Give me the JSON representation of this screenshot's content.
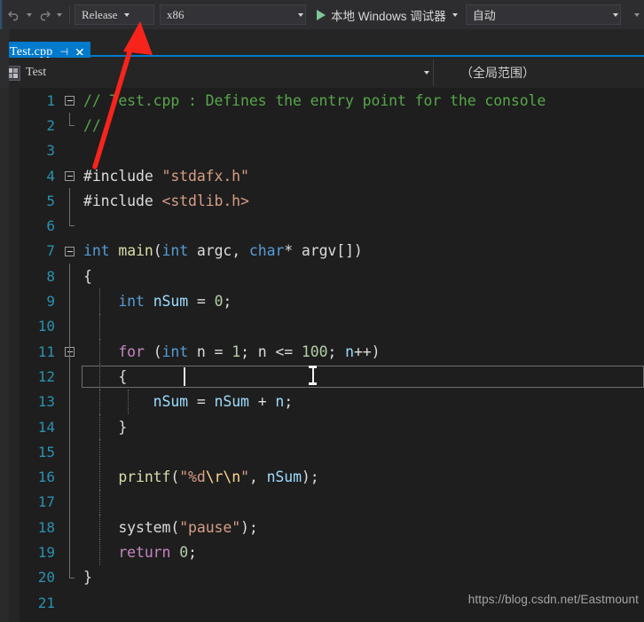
{
  "toolbar": {
    "undo_icon": "undo-arrow-icon",
    "redo_icon": "redo-arrow-icon",
    "configuration": "Release",
    "platform": "x86",
    "run_label": "本地 Windows 调试器",
    "attach_label": "自动",
    "play_icon": "play-triangle-icon",
    "caret_icon": "chevron-down-icon"
  },
  "tabstrip": {
    "active_tab": "Test.cpp",
    "pin_icon": "pin-icon",
    "close_icon": "close-x-icon"
  },
  "navbar": {
    "project_icon": "project-puzzle-icon",
    "project": "Test",
    "scope": "（全局范围）",
    "caret_icon": "chevron-down-icon"
  },
  "editor": {
    "cursor_icon": "text-ibeam-cursor",
    "lines": [
      {
        "n": "1",
        "fold": "open",
        "guides": [],
        "tokens": [
          {
            "t": "// Test.cpp : Defines the entry point for the console",
            "c": "tk-cmt"
          }
        ]
      },
      {
        "n": "2",
        "fold": "end",
        "guides": [],
        "tokens": [
          {
            "t": "//",
            "c": "tk-cmt"
          }
        ]
      },
      {
        "n": "3",
        "fold": "none",
        "guides": [],
        "tokens": []
      },
      {
        "n": "4",
        "fold": "open",
        "guides": [],
        "tokens": [
          {
            "t": "#include ",
            "c": "tk-pp"
          },
          {
            "t": "\"stdafx.h\"",
            "c": "tk-str"
          }
        ]
      },
      {
        "n": "5",
        "fold": "line",
        "guides": [],
        "tokens": [
          {
            "t": "#include ",
            "c": "tk-pp"
          },
          {
            "t": "<stdlib.h>",
            "c": "tk-str"
          }
        ]
      },
      {
        "n": "6",
        "fold": "endhalf",
        "guides": [],
        "tokens": []
      },
      {
        "n": "7",
        "fold": "open",
        "guides": [],
        "tokens": [
          {
            "t": "int",
            "c": "tk-kw"
          },
          {
            "t": " ",
            "c": "tk-pun"
          },
          {
            "t": "main",
            "c": "tk-fn"
          },
          {
            "t": "(",
            "c": "tk-pun"
          },
          {
            "t": "int",
            "c": "tk-kw"
          },
          {
            "t": " argc, ",
            "c": "tk-pun"
          },
          {
            "t": "char",
            "c": "tk-kw"
          },
          {
            "t": "* argv[])",
            "c": "tk-pun"
          }
        ]
      },
      {
        "n": "8",
        "fold": "line",
        "guides": [],
        "tokens": [
          {
            "t": "{",
            "c": "tk-pun"
          }
        ]
      },
      {
        "n": "9",
        "fold": "line",
        "guides": [
          "g1"
        ],
        "tokens": [
          {
            "t": "    ",
            "c": "tk-pun"
          },
          {
            "t": "int",
            "c": "tk-kw"
          },
          {
            "t": " ",
            "c": "tk-pun"
          },
          {
            "t": "nSum",
            "c": "tk-id"
          },
          {
            "t": " = ",
            "c": "tk-pun"
          },
          {
            "t": "0",
            "c": "tk-num"
          },
          {
            "t": ";",
            "c": "tk-pun"
          }
        ]
      },
      {
        "n": "10",
        "fold": "line",
        "guides": [
          "g1"
        ],
        "tokens": []
      },
      {
        "n": "11",
        "fold": "openline",
        "guides": [
          "g1"
        ],
        "tokens": [
          {
            "t": "    ",
            "c": "tk-pun"
          },
          {
            "t": "for",
            "c": "tk-kw2"
          },
          {
            "t": " (",
            "c": "tk-pun"
          },
          {
            "t": "int",
            "c": "tk-kw"
          },
          {
            "t": " n = ",
            "c": "tk-pun"
          },
          {
            "t": "1",
            "c": "tk-num"
          },
          {
            "t": "; n <= ",
            "c": "tk-pun"
          },
          {
            "t": "100",
            "c": "tk-num"
          },
          {
            "t": "; ",
            "c": "tk-pun"
          },
          {
            "t": "n",
            "c": "tk-id"
          },
          {
            "t": "++)",
            "c": "tk-pun"
          }
        ]
      },
      {
        "n": "12",
        "fold": "line",
        "guides": [
          "g1"
        ],
        "current": true,
        "tokens": [
          {
            "t": "    {",
            "c": "tk-pun"
          }
        ]
      },
      {
        "n": "13",
        "fold": "line",
        "guides": [
          "g1",
          "g2"
        ],
        "tokens": [
          {
            "t": "        ",
            "c": "tk-pun"
          },
          {
            "t": "nSum",
            "c": "tk-id"
          },
          {
            "t": " = ",
            "c": "tk-pun"
          },
          {
            "t": "nSum",
            "c": "tk-id"
          },
          {
            "t": " + ",
            "c": "tk-pun"
          },
          {
            "t": "n",
            "c": "tk-id"
          },
          {
            "t": ";",
            "c": "tk-pun"
          }
        ]
      },
      {
        "n": "14",
        "fold": "line",
        "guides": [
          "g1"
        ],
        "tokens": [
          {
            "t": "    }",
            "c": "tk-pun"
          }
        ]
      },
      {
        "n": "15",
        "fold": "line",
        "guides": [
          "g1"
        ],
        "tokens": []
      },
      {
        "n": "16",
        "fold": "line",
        "guides": [
          "g1"
        ],
        "tokens": [
          {
            "t": "    ",
            "c": "tk-pun"
          },
          {
            "t": "printf",
            "c": "tk-fn"
          },
          {
            "t": "(",
            "c": "tk-pun"
          },
          {
            "t": "\"%d",
            "c": "tk-str"
          },
          {
            "t": "\\r\\n",
            "c": "tk-esc"
          },
          {
            "t": "\"",
            "c": "tk-str"
          },
          {
            "t": ", ",
            "c": "tk-pun"
          },
          {
            "t": "nSum",
            "c": "tk-id"
          },
          {
            "t": ");",
            "c": "tk-pun"
          }
        ]
      },
      {
        "n": "17",
        "fold": "line",
        "guides": [
          "g1"
        ],
        "tokens": []
      },
      {
        "n": "18",
        "fold": "line",
        "guides": [
          "g1"
        ],
        "tokens": [
          {
            "t": "    ",
            "c": "tk-pun"
          },
          {
            "t": "system",
            "c": "tk-pun"
          },
          {
            "t": "(",
            "c": "tk-pun"
          },
          {
            "t": "\"pause\"",
            "c": "tk-str"
          },
          {
            "t": ");",
            "c": "tk-pun"
          }
        ]
      },
      {
        "n": "19",
        "fold": "line",
        "guides": [
          "g1"
        ],
        "tokens": [
          {
            "t": "    ",
            "c": "tk-pun"
          },
          {
            "t": "return",
            "c": "tk-kw2"
          },
          {
            "t": " ",
            "c": "tk-pun"
          },
          {
            "t": "0",
            "c": "tk-num"
          },
          {
            "t": ";",
            "c": "tk-pun"
          }
        ]
      },
      {
        "n": "20",
        "fold": "end",
        "guides": [],
        "tokens": [
          {
            "t": "}",
            "c": "tk-pun"
          }
        ]
      },
      {
        "n": "21",
        "fold": "none",
        "guides": [],
        "tokens": []
      }
    ]
  },
  "watermark": "https://blog.csdn.net/Eastmount",
  "annotation": {
    "arrow_color": "#f8241c",
    "arrow_name": "red-pointer-arrow"
  },
  "colors": {
    "accent": "#007acc",
    "toolbar_bg": "#2d2d30",
    "editor_bg": "#1e1e1e",
    "linenumber": "#2b91af",
    "comment": "#57a64a",
    "string": "#d69d85",
    "keyword": "#569cd6"
  }
}
